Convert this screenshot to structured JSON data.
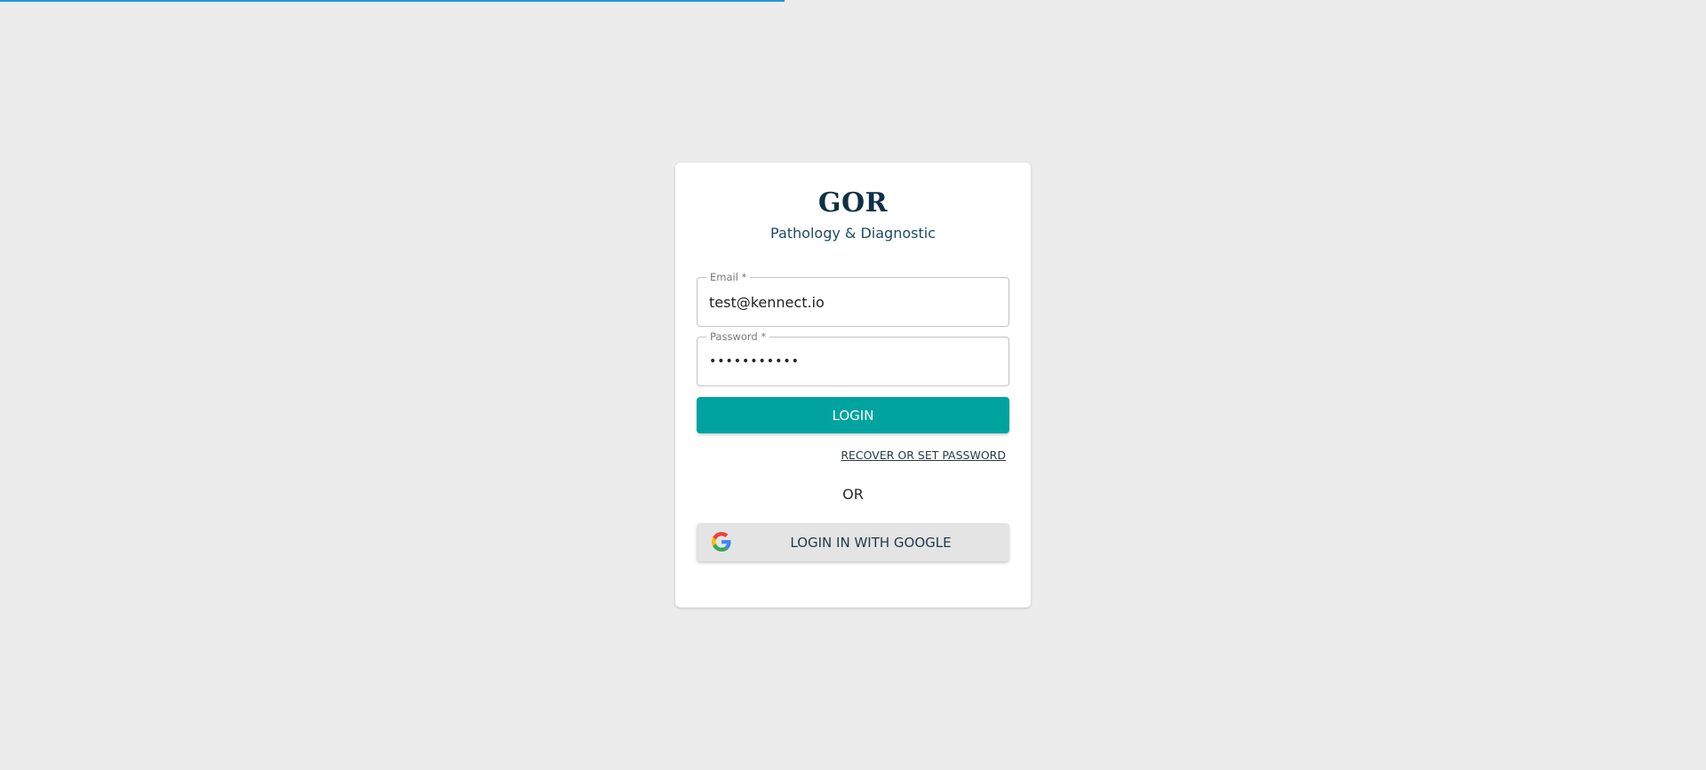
{
  "top_progress": {
    "value_percent": 46,
    "color": "#1e96dc"
  },
  "brand": {
    "name": "GOR",
    "subtitle": "Pathology & Diagnostic",
    "color": "#0f3047"
  },
  "form": {
    "email": {
      "label": "Email *",
      "value": "test@kennect.io"
    },
    "password": {
      "label": "Password *",
      "value": "•••••••••••"
    },
    "login_label": "LOGIN",
    "recover_label": "RECOVER OR SET PASSWORD",
    "or_label": "OR",
    "google_label": "LOGIN IN WITH GOOGLE",
    "google_icon": "google-icon"
  },
  "colors": {
    "background": "#ececec",
    "primary_button": "#00a3a0",
    "google_button": "#e4e4e4"
  }
}
